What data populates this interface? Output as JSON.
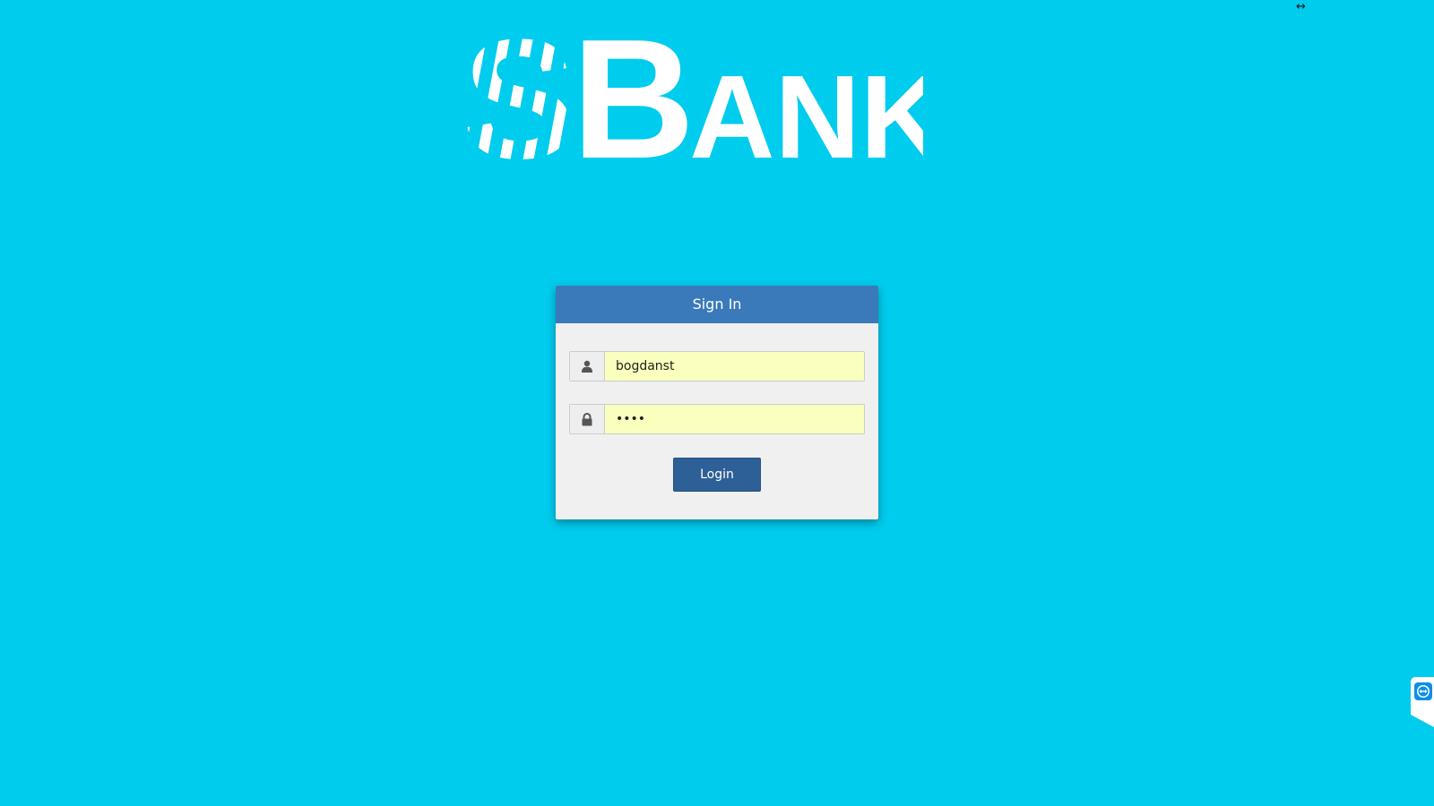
{
  "logo": {
    "text": "BANK",
    "color": "#FFFFFF"
  },
  "signin": {
    "title": "Sign In",
    "username": {
      "value": "bogdanst",
      "icon": "user-icon"
    },
    "password": {
      "value": "••••",
      "icon": "lock-icon"
    },
    "login_label": "Login"
  },
  "colors": {
    "background": "#00CCEE",
    "header": "#3A7ABA",
    "button": "#2D6096",
    "autofill": "#FAFFBD"
  },
  "overlay": {
    "cursor_glyph": "↔",
    "remote_icon": "teamviewer-icon"
  }
}
